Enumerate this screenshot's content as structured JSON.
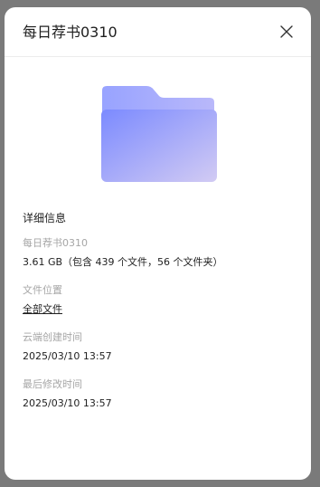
{
  "dialog": {
    "title": "每日荐书0310",
    "close_icon": "close-icon"
  },
  "folder": {
    "icon": "folder-icon",
    "colors": {
      "back": "#9aa6ff",
      "front_start": "#7c8bff",
      "front_end": "#cfc8f4"
    }
  },
  "details": {
    "section_title": "详细信息",
    "name_label": "每日荐书0310",
    "size_value": "3.61 GB（包含 439 个文件，56 个文件夹）",
    "location_label": "文件位置",
    "location_value": "全部文件",
    "created_label": "云端创建时间",
    "created_value": "2025/03/10 13:57",
    "modified_label": "最后修改时间",
    "modified_value": "2025/03/10 13:57"
  }
}
